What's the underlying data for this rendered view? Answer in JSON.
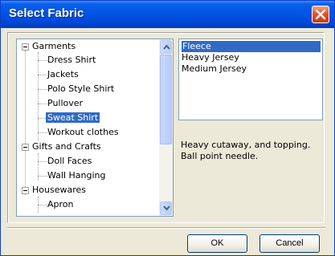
{
  "window": {
    "title": "Select Fabric"
  },
  "tree": {
    "items": [
      {
        "label": "Garments",
        "level": 0,
        "expanded": true
      },
      {
        "label": "Dress Shirt",
        "level": 1
      },
      {
        "label": "Jackets",
        "level": 1
      },
      {
        "label": "Polo Style Shirt",
        "level": 1
      },
      {
        "label": "Pullover",
        "level": 1
      },
      {
        "label": "Sweat Shirt",
        "level": 1,
        "selected": true
      },
      {
        "label": "Workout clothes",
        "level": 1
      },
      {
        "label": "Gifts and Crafts",
        "level": 0,
        "expanded": true
      },
      {
        "label": "Doll Faces",
        "level": 1
      },
      {
        "label": "Wall Hanging",
        "level": 1
      },
      {
        "label": "Housewares",
        "level": 0,
        "expanded": true
      },
      {
        "label": "Apron",
        "level": 1
      }
    ]
  },
  "fabric_list": {
    "items": [
      {
        "label": "Fleece",
        "selected": true
      },
      {
        "label": "Heavy Jersey"
      },
      {
        "label": "Medium Jersey"
      }
    ]
  },
  "description": {
    "line1": "Heavy cutaway, and topping.",
    "line2": "Ball point needle."
  },
  "buttons": {
    "ok": "OK",
    "cancel": "Cancel"
  }
}
